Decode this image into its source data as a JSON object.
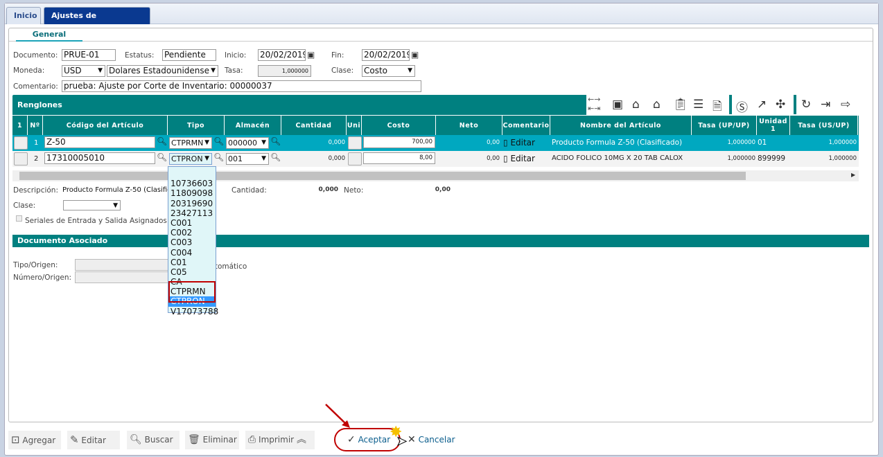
{
  "tabs": [
    {
      "label": "Inicio"
    },
    {
      "label": "Ajustes de Inventarios",
      "close": "×"
    }
  ],
  "subtab": "General",
  "form": {
    "documento_label": "Documento:",
    "documento": "PRUE-01",
    "estatus_label": "Estatus:",
    "estatus": "Pendiente",
    "inicio_label": "Inicio:",
    "inicio": "20/02/2019",
    "fin_label": "Fin:",
    "fin": "20/02/2019",
    "moneda_label": "Moneda:",
    "moneda": "USD",
    "moneda_desc": "Dolares Estadounidense",
    "tasa_label": "Tasa:",
    "tasa": "1,000000",
    "clase_label": "Clase:",
    "clase": "Costo",
    "comentario_label": "Comentario:",
    "comentario": "prueba: Ajuste por Corte de Inventario: 00000037"
  },
  "renglones": {
    "title": "Renglones",
    "columns": [
      "1",
      "Nº",
      "Código del Artículo",
      "Tipo",
      "Almacén",
      "Cantidad",
      "Uni",
      "Costo",
      "Neto",
      "Comentario",
      "Nombre del Artículo",
      "Tasa (UP/UP)",
      "Unidad 1",
      "Tasa (US/UP)"
    ],
    "rows": [
      {
        "n": "1",
        "codigo": "Z-50",
        "tipo": "CTPRMN",
        "almacen": "000000",
        "cantidad": "0,000",
        "costo": "700,00",
        "neto": "0,00",
        "comentario": "Editar",
        "nombre": "Producto Formula Z-50 (Clasificado)",
        "tasa_up": "1,000000",
        "unidad": "01",
        "tasa_us": "1,000000"
      },
      {
        "n": "2",
        "codigo": "17310005010",
        "tipo": "CTPRON",
        "almacen": "001",
        "cantidad": "0,000",
        "costo": "8,00",
        "neto": "0,00",
        "comentario": "Editar",
        "nombre": "ACIDO FOLICO 10MG X 20 TAB CALOX",
        "tasa_up": "1,000000",
        "unidad": "899999",
        "tasa_us": "1,000000"
      }
    ]
  },
  "dropdown": {
    "options": [
      "",
      "10736603",
      "11809098",
      "20319690",
      "23427113",
      "C001",
      "C002",
      "C003",
      "C004",
      "C01",
      "C05",
      "CA",
      "CTPRMN",
      "CTPRON",
      "V17073788"
    ],
    "selected": "CTPRON"
  },
  "detail": {
    "descripcion_label": "Descripción:",
    "descripcion": "Producto Formula Z-50 (Clasificado)",
    "cantidad_label": "Cantidad:",
    "cantidad": "0,000",
    "neto_label": "Neto:",
    "neto": "0,00",
    "clase_label": "Clase:",
    "seriales_label": "Seriales de Entrada y Salida Asignados"
  },
  "doc_asociado": {
    "title": "Documento Asociado",
    "tipo_label": "Tipo/Origen:",
    "numero_label": "Número/Origen:",
    "auto_label": "Automático"
  },
  "footer": {
    "agregar": "Agregar",
    "editar": "Editar",
    "buscar": "Buscar",
    "eliminar": "Eliminar",
    "imprimir": "Imprimir",
    "aceptar": "Aceptar",
    "cancelar": "Cancelar"
  },
  "colors": {
    "teal": "#008080",
    "row_selected": "#00a8c0",
    "tab_active": "#003a8c",
    "highlight": "#c00000"
  }
}
